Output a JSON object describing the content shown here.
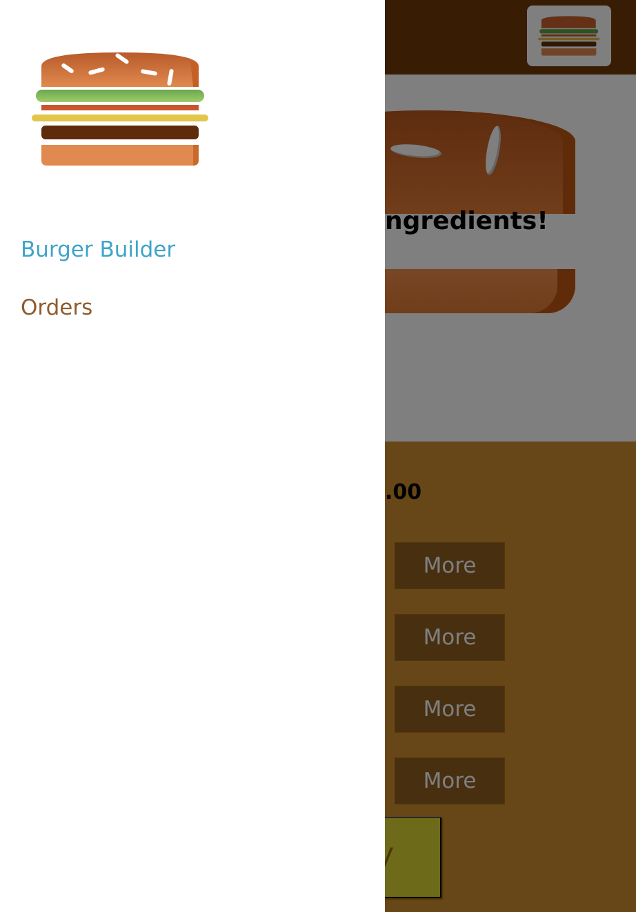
{
  "toolbar": {
    "logo_icon": "burger-logo-icon"
  },
  "burger": {
    "empty_message": "ngredients!"
  },
  "controls": {
    "price_fragment": ".00",
    "more_buttons": [
      "More",
      "More",
      "More",
      "More"
    ],
    "order_fragment": "V"
  },
  "drawer": {
    "logo_icon": "burger-logo-icon",
    "nav": [
      {
        "label": "Burger Builder",
        "active": true
      },
      {
        "label": "Orders",
        "active": false
      }
    ]
  },
  "colors": {
    "toolbar": "#703B09",
    "controls_bg": "#CF8F2E",
    "nav_active": "#40A4C8",
    "nav_inactive": "#8F5C2C",
    "backdrop": "rgba(0,0,0,0.5)"
  }
}
